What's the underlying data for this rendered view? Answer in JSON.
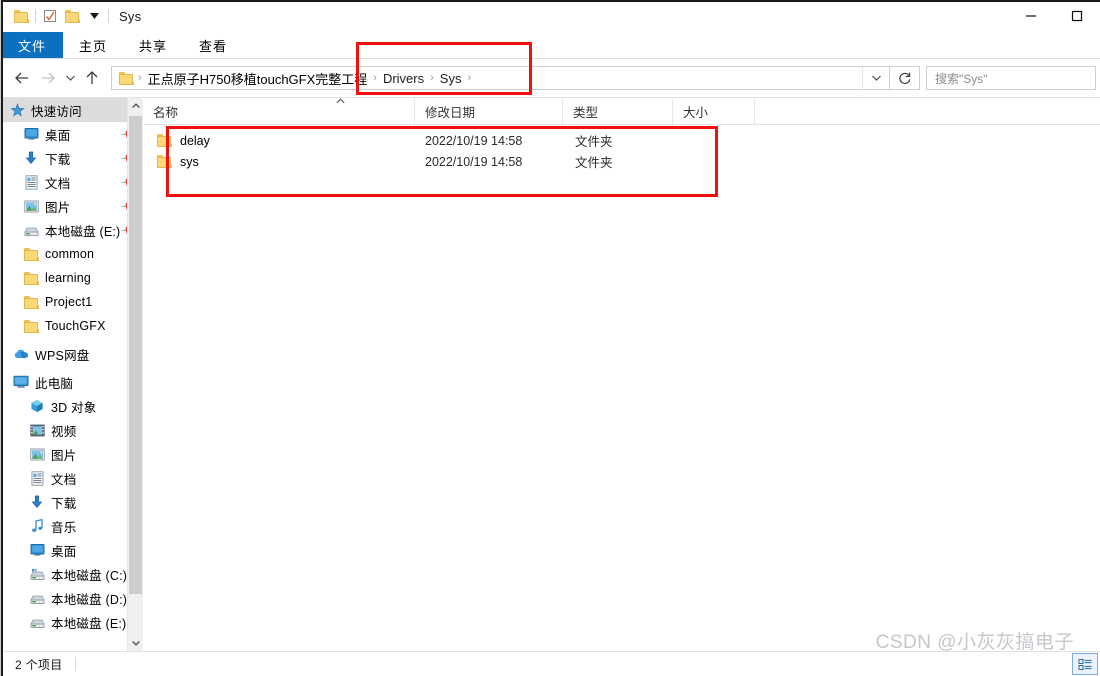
{
  "window": {
    "title": "Sys",
    "quick_access_icons": [
      "folder-icon",
      "properties-icon",
      "new-folder-icon",
      "customize-dropdown-icon"
    ],
    "controls": {
      "minimize": "—",
      "maximize": "□"
    }
  },
  "ribbon": {
    "tabs": [
      {
        "label": "文件",
        "active": true
      },
      {
        "label": "主页",
        "active": false
      },
      {
        "label": "共享",
        "active": false
      },
      {
        "label": "查看",
        "active": false
      }
    ]
  },
  "navigation": {
    "back_icon": "arrow-left-icon",
    "forward_icon": "arrow-right-icon",
    "recent_icon": "chevron-down-icon",
    "up_icon": "arrow-up-icon",
    "breadcrumb": [
      "正点原子H750移植touchGFX完整工程",
      "Drivers",
      "Sys"
    ],
    "separator": "›",
    "address_dropdown_icon": "chevron-down-icon",
    "refresh_icon": "refresh-icon"
  },
  "search": {
    "placeholder": "搜索\"Sys\""
  },
  "sidebar": {
    "items": [
      {
        "label": "快速访问",
        "icon": "quick-access-star-icon",
        "indent": 0,
        "selected": true,
        "pinned": false
      },
      {
        "label": "桌面",
        "icon": "desktop-icon",
        "indent": 1,
        "selected": false,
        "pinned": true
      },
      {
        "label": "下载",
        "icon": "download-icon",
        "indent": 1,
        "selected": false,
        "pinned": true
      },
      {
        "label": "文档",
        "icon": "documents-icon",
        "indent": 1,
        "selected": false,
        "pinned": true
      },
      {
        "label": "图片",
        "icon": "pictures-icon",
        "indent": 1,
        "selected": false,
        "pinned": true
      },
      {
        "label": "本地磁盘 (E:)",
        "icon": "drive-icon",
        "indent": 1,
        "selected": false,
        "pinned": true
      },
      {
        "label": "common",
        "icon": "folder-icon",
        "indent": 1,
        "selected": false,
        "pinned": false
      },
      {
        "label": "learning",
        "icon": "folder-icon",
        "indent": 1,
        "selected": false,
        "pinned": false
      },
      {
        "label": "Project1",
        "icon": "folder-icon",
        "indent": 1,
        "selected": false,
        "pinned": false
      },
      {
        "label": "TouchGFX",
        "icon": "folder-icon",
        "indent": 1,
        "selected": false,
        "pinned": false
      },
      {
        "label": "WPS网盘",
        "icon": "cloud-icon",
        "indent": 0,
        "selected": false,
        "pinned": false
      },
      {
        "label": "此电脑",
        "icon": "this-pc-icon",
        "indent": 0,
        "selected": false,
        "pinned": false
      },
      {
        "label": "3D 对象",
        "icon": "3d-objects-icon",
        "indent": 1,
        "selected": false,
        "pinned": false
      },
      {
        "label": "视频",
        "icon": "videos-icon",
        "indent": 1,
        "selected": false,
        "pinned": false
      },
      {
        "label": "图片",
        "icon": "pictures-icon",
        "indent": 1,
        "selected": false,
        "pinned": false
      },
      {
        "label": "文档",
        "icon": "documents-icon",
        "indent": 1,
        "selected": false,
        "pinned": false
      },
      {
        "label": "下载",
        "icon": "download-icon",
        "indent": 1,
        "selected": false,
        "pinned": false
      },
      {
        "label": "音乐",
        "icon": "music-icon",
        "indent": 1,
        "selected": false,
        "pinned": false
      },
      {
        "label": "桌面",
        "icon": "desktop-icon",
        "indent": 1,
        "selected": false,
        "pinned": false
      },
      {
        "label": "本地磁盘 (C:)",
        "icon": "system-drive-icon",
        "indent": 1,
        "selected": false,
        "pinned": false
      },
      {
        "label": "本地磁盘 (D:)",
        "icon": "drive-icon",
        "indent": 1,
        "selected": false,
        "pinned": false
      },
      {
        "label": "本地磁盘 (E:)",
        "icon": "drive-icon",
        "indent": 1,
        "selected": false,
        "pinned": false
      }
    ]
  },
  "filelist": {
    "columns": [
      {
        "label": "名称",
        "sorted": true,
        "sort_dir": "asc"
      },
      {
        "label": "修改日期",
        "sorted": false
      },
      {
        "label": "类型",
        "sorted": false
      },
      {
        "label": "大小",
        "sorted": false
      }
    ],
    "rows": [
      {
        "name": "delay",
        "date": "2022/10/19 14:58",
        "type": "文件夹",
        "size": "",
        "icon": "folder-icon"
      },
      {
        "name": "sys",
        "date": "2022/10/19 14:58",
        "type": "文件夹",
        "size": "",
        "icon": "folder-icon"
      }
    ]
  },
  "statusbar": {
    "item_count": "2 个项目",
    "view_details_icon": "details-view-icon",
    "view_large_icons_icon": "large-icons-view-icon"
  },
  "watermark": {
    "text": "CSDN @小灰灰搞电子"
  },
  "annotations": {
    "colors": {
      "highlight": "#f40f0f"
    },
    "boxes": [
      {
        "name": "breadcrumb-highlight"
      },
      {
        "name": "filelist-highlight"
      }
    ]
  }
}
